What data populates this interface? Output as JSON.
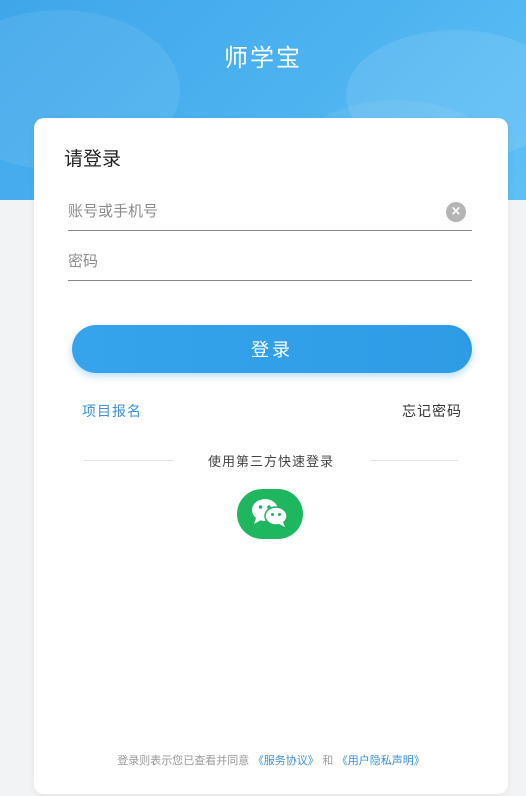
{
  "header": {
    "title": "师学宝"
  },
  "login": {
    "heading": "请登录",
    "account_placeholder": "账号或手机号",
    "password_placeholder": "密码",
    "clear_icon": "×",
    "submit_label": "登录",
    "register_link": "项目报名",
    "forgot_link": "忘记密码",
    "third_party_label": "使用第三方快速登录",
    "third_party_icon": "wechat-icon"
  },
  "agreement": {
    "prefix": "登录则表示您已查看并同意",
    "terms_link": "《服务协议》",
    "connector": "和",
    "privacy_link": "《用户隐私声明》"
  },
  "colors": {
    "primary": "#35a4ec",
    "link": "#3d8fd6",
    "wechat": "#1fb660"
  }
}
